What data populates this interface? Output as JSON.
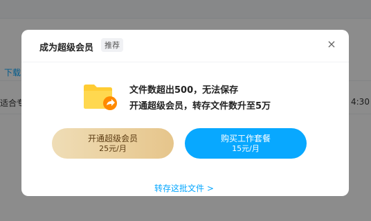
{
  "background": {
    "left_text_1": "下载",
    "left_text_2": "适合专",
    "right_time": "4:30"
  },
  "dialog": {
    "title": "成为超级会员",
    "tag": "推荐",
    "close_glyph": "×",
    "message_line1": "文件数超出500，无法保存",
    "message_line2": "开通超级会员，转存文件数升至5万",
    "vip_button": {
      "title": "开通超级会员",
      "price": "25元/月"
    },
    "work_button": {
      "title": "购买工作套餐",
      "price": "15元/月"
    },
    "transfer_link": "转存这批文件 >"
  },
  "colors": {
    "accent_blue": "#08a8ff",
    "vip_gold_start": "#efddb6",
    "vip_gold_end": "#e6c58b",
    "folder_yellow": "#ffd040",
    "badge_orange": "#ff8a00"
  },
  "icons": {
    "folder_icon": "folder-share-icon",
    "close_icon": "close-icon"
  }
}
